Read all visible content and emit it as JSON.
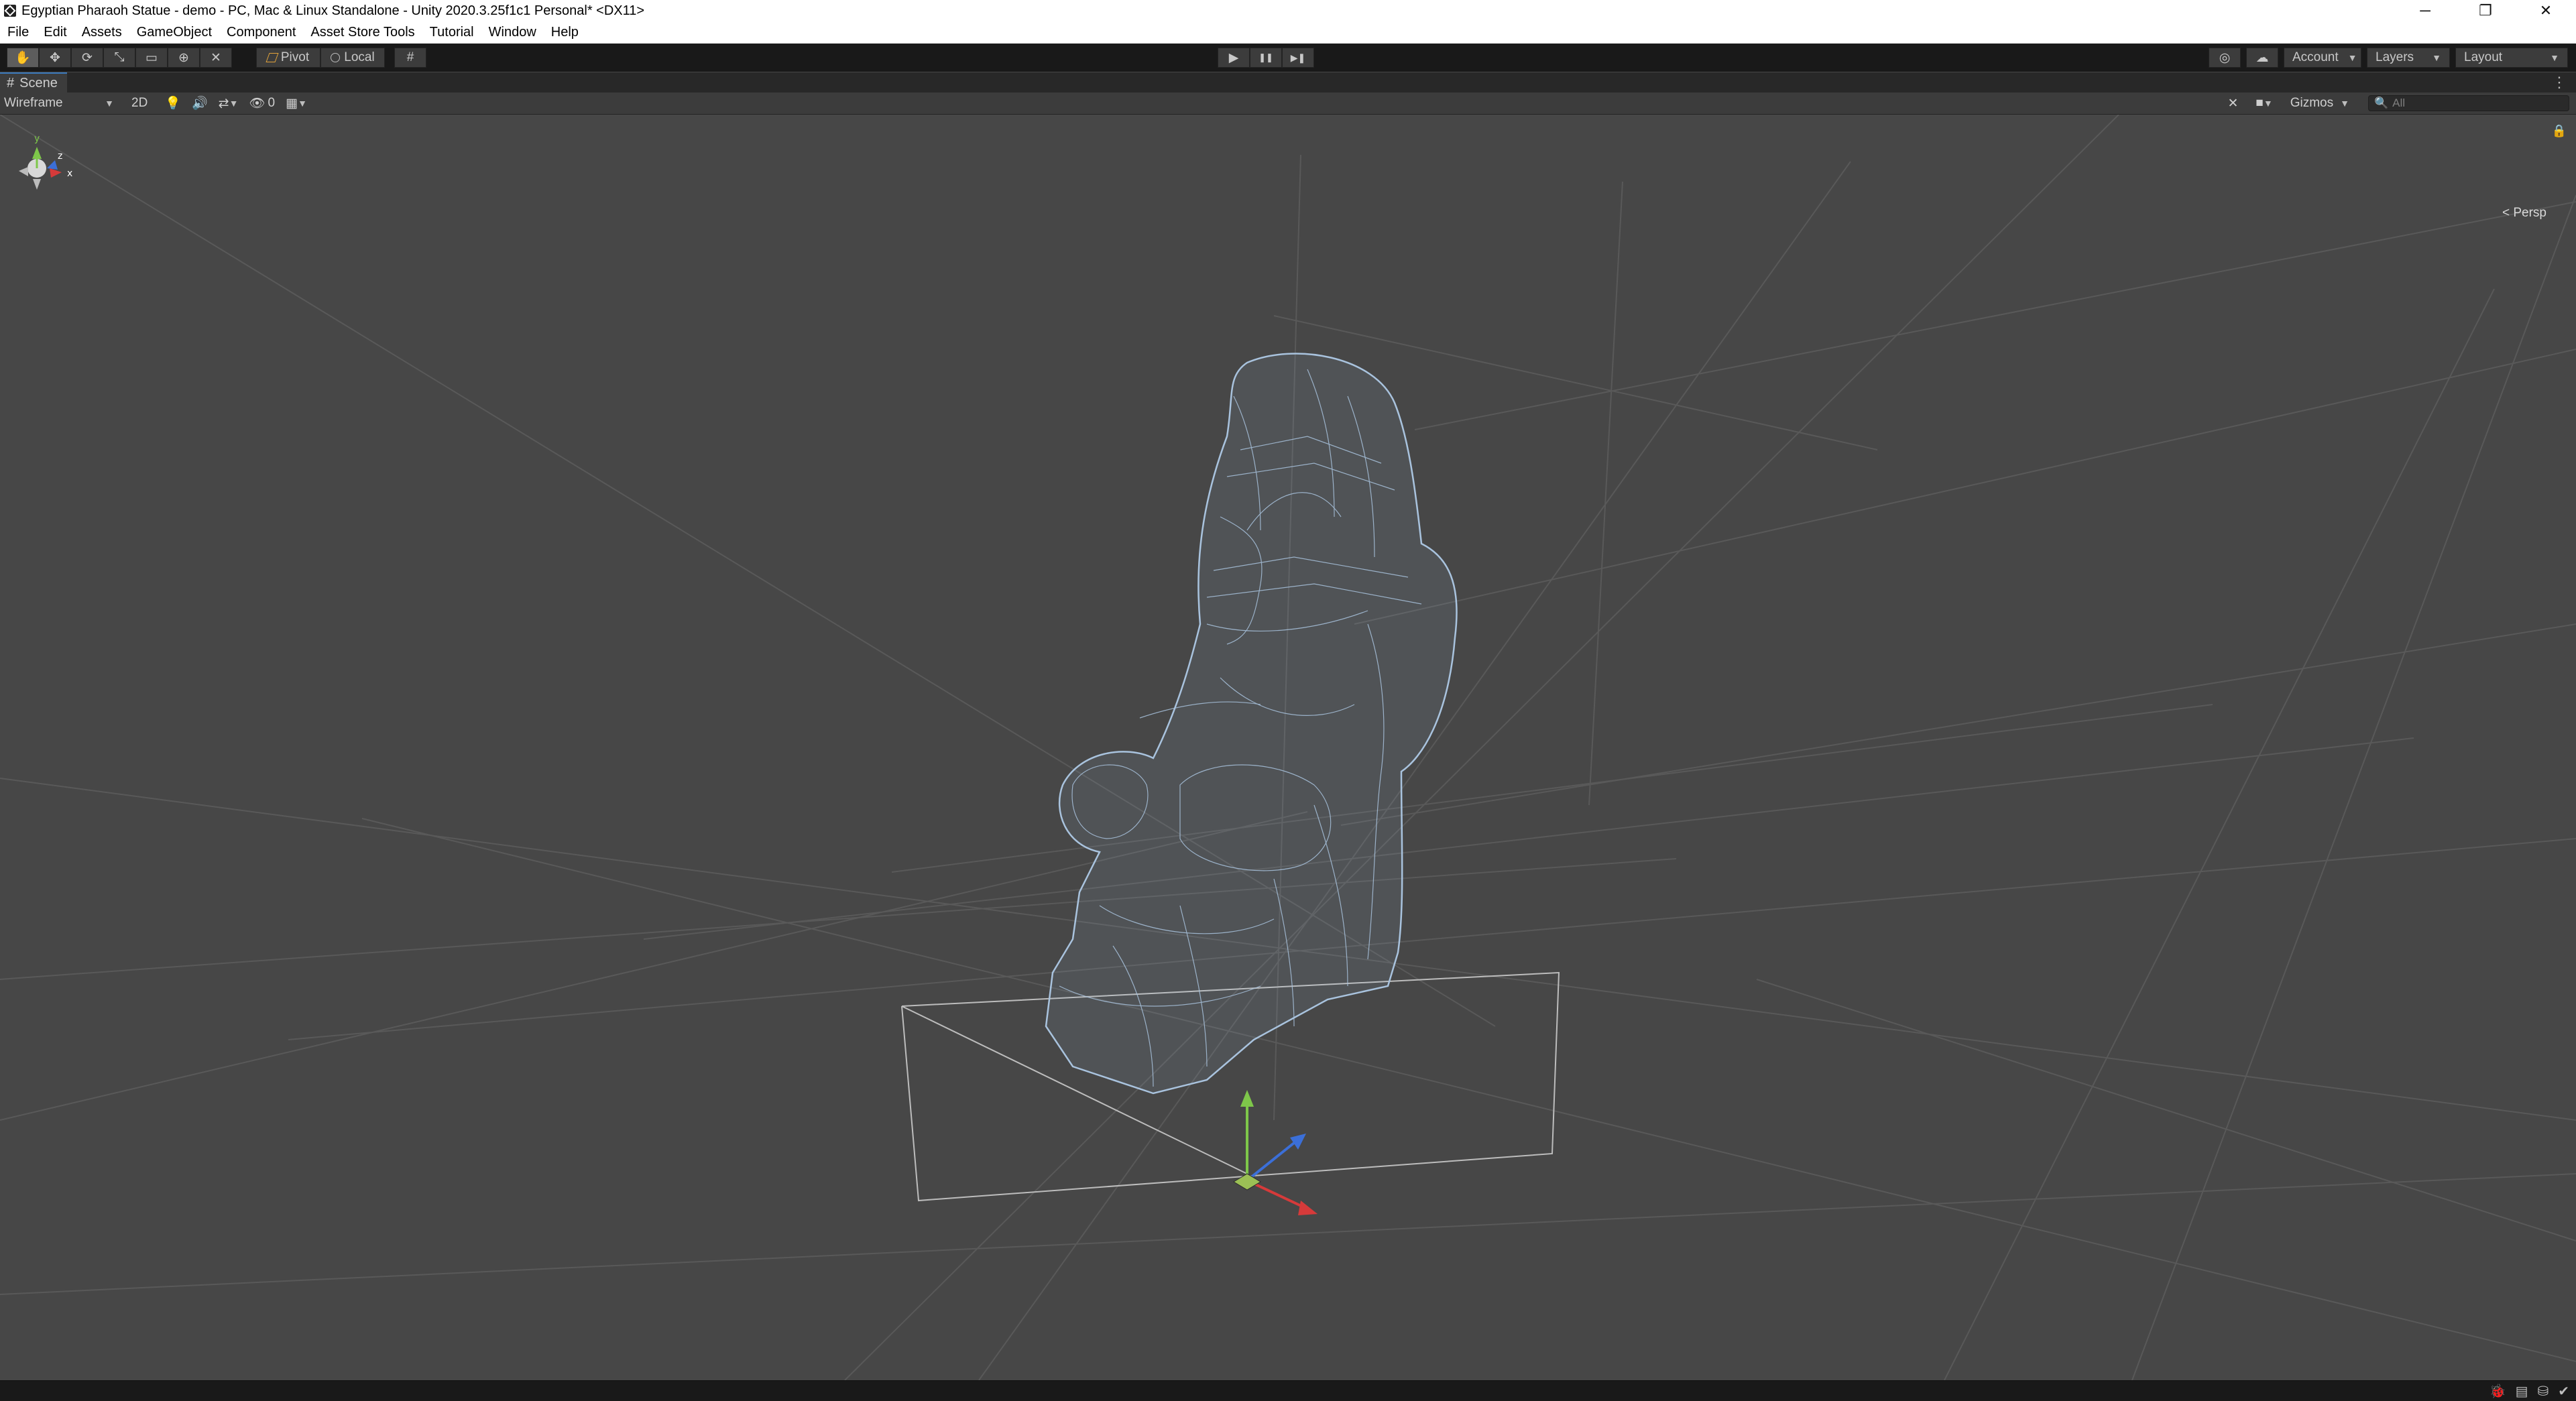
{
  "window": {
    "title": "Egyptian Pharaoh Statue - demo - PC, Mac & Linux Standalone - Unity 2020.3.25f1c1 Personal* <DX11>",
    "controls": {
      "minimize": "─",
      "maximize": "❐",
      "close": "✕"
    }
  },
  "menu": [
    "File",
    "Edit",
    "Assets",
    "GameObject",
    "Component",
    "Asset Store Tools",
    "Tutorial",
    "Window",
    "Help"
  ],
  "toolbar": {
    "tools": [
      {
        "icon": "hand-icon",
        "glyph": "✋",
        "active": true
      },
      {
        "icon": "move-icon",
        "glyph": "✥"
      },
      {
        "icon": "rotate-icon",
        "glyph": "⟳"
      },
      {
        "icon": "scale-icon",
        "glyph": "⤡"
      },
      {
        "icon": "rect-icon",
        "glyph": "▭"
      },
      {
        "icon": "transform-icon",
        "glyph": "⊕"
      },
      {
        "icon": "custom-tool-icon",
        "glyph": "✕"
      }
    ],
    "pivot_label": "Pivot",
    "local_label": "Local",
    "snap_glyph": "#",
    "play_glyph": "▶",
    "pause_glyph": "❚❚",
    "step_glyph": "▶❚",
    "services_glyph": "◎",
    "cloud_glyph": "☁",
    "account_label": "Account",
    "layers_label": "Layers",
    "layout_label": "Layout"
  },
  "scene_tab": {
    "label": "Scene",
    "menu_glyph": "⋮"
  },
  "scene_toolbar": {
    "draw_mode": "Wireframe",
    "two_d_label": "2D",
    "hidden_count": "0",
    "gizmos_label": "Gizmos",
    "search_placeholder": "All"
  },
  "scene_gizmo": {
    "projection_label": "Persp",
    "axes": [
      "y",
      "z",
      "x"
    ]
  },
  "status": {
    "icons": [
      "bug-icon",
      "layers-icon",
      "cache-icon",
      "check-icon"
    ]
  },
  "colors": {
    "axis_x": "#d63a3a",
    "axis_y": "#7ec74a",
    "axis_z": "#3b6fd8",
    "wire": "#a9c3de",
    "selection": "#3a79bb"
  }
}
